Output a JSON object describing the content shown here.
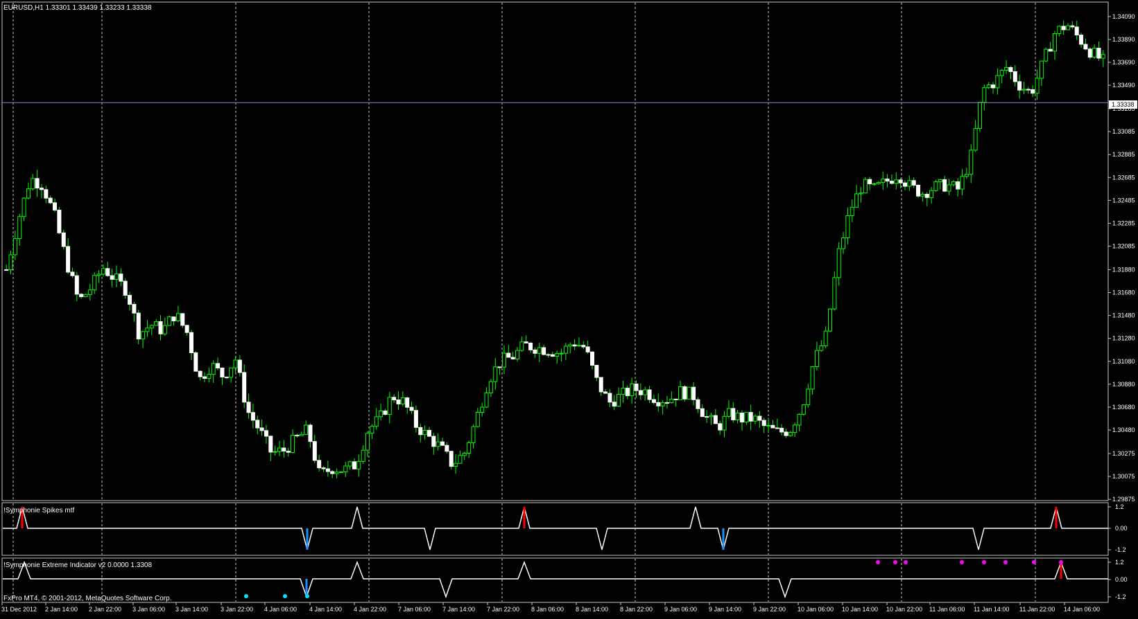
{
  "symbol_header": "EURUSD,H1  1.33301 1.33439 1.33233 1.33338",
  "current_price_label": "1.33338",
  "current_price": 1.33338,
  "price_ticks": [
    "1.34090",
    "1.33890",
    "1.33690",
    "1.33490",
    "1.33285",
    "1.33085",
    "1.32885",
    "1.32685",
    "1.32485",
    "1.32285",
    "1.32085",
    "1.31880",
    "1.31680",
    "1.31480",
    "1.31280",
    "1.31080",
    "1.30880",
    "1.30680",
    "1.30480",
    "1.30275",
    "1.30075",
    "1.29875"
  ],
  "price_tick_values": [
    1.3409,
    1.3389,
    1.3369,
    1.3349,
    1.33285,
    1.33085,
    1.32885,
    1.32685,
    1.32485,
    1.32285,
    1.32085,
    1.3188,
    1.3168,
    1.3148,
    1.3128,
    1.3108,
    1.3088,
    1.3068,
    1.3048,
    1.30275,
    1.30075,
    1.29875
  ],
  "price_range": [
    1.2987,
    1.3421
  ],
  "indicator1": {
    "label": "!Symphonie Spikes mtf",
    "ticks": [
      "1.2",
      "0.00",
      "-1.2"
    ],
    "tick_values": [
      1.2,
      0,
      -1.2
    ],
    "range": [
      -1.2,
      1.2
    ]
  },
  "indicator2": {
    "label": "!Symphonie Extreme Indicator v2 0.0000 1.3308",
    "ticks": [
      "1.2",
      "0.00",
      "-1.2"
    ],
    "tick_values": [
      1.2,
      0,
      -1.2
    ],
    "range": [
      -1.2,
      1.2
    ]
  },
  "copyright": "FxPro MT4, © 2001-2012, MetaQuotes Software Corp.",
  "time_labels": [
    "31 Dec 2012",
    "2 Jan 14:00",
    "2 Jan 22:00",
    "3 Jan 06:00",
    "3 Jan 14:00",
    "3 Jan 22:00",
    "4 Jan 06:00",
    "4 Jan 14:00",
    "4 Jan 22:00",
    "7 Jan 06:00",
    "7 Jan 14:00",
    "7 Jan 22:00",
    "8 Jan 06:00",
    "8 Jan 14:00",
    "8 Jan 22:00",
    "9 Jan 06:00",
    "9 Jan 14:00",
    "9 Jan 22:00",
    "10 Jan 06:00",
    "10 Jan 14:00",
    "10 Jan 22:00",
    "11 Jan 06:00",
    "11 Jan 14:00",
    "11 Jan 22:00",
    "14 Jan 06:00"
  ],
  "colors": {
    "bull": "#00ff00",
    "bear": "#ffffff",
    "wick": "#00ff00",
    "grid": "#ffffff",
    "price_line": "#7f8fbf",
    "spike_red": "#ff0000",
    "spike_blue": "#1e90ff",
    "dot_cyan": "#00e5ff",
    "dot_magenta": "#ff00ff"
  },
  "chart_data": {
    "type": "candlestick",
    "close_path": [
      1.3188,
      1.3232,
      1.3268,
      1.3262,
      1.3235,
      1.3195,
      1.316,
      1.3172,
      1.319,
      1.318,
      1.317,
      1.3132,
      1.314,
      1.3135,
      1.315,
      1.3133,
      1.3092,
      1.3105,
      1.3095,
      1.311,
      1.3065,
      1.3048,
      1.3028,
      1.303,
      1.304,
      1.3048,
      1.3008,
      1.3015,
      1.3013,
      1.3018,
      1.3048,
      1.3058,
      1.3078,
      1.3072,
      1.3052,
      1.3042,
      1.3033,
      1.3018,
      1.3028,
      1.3058,
      1.3092,
      1.3108,
      1.3112,
      1.3122,
      1.312,
      1.3118,
      1.3115,
      1.3125,
      1.312,
      1.309,
      1.3072,
      1.3078,
      1.3084,
      1.3082,
      1.3075,
      1.3075,
      1.3082,
      1.3078,
      1.306,
      1.305,
      1.3062,
      1.3058,
      1.3058,
      1.305,
      1.3046,
      1.3048,
      1.3068,
      1.3108,
      1.313,
      1.32,
      1.324,
      1.3262,
      1.3258,
      1.3265,
      1.3272,
      1.326,
      1.3255,
      1.326,
      1.3262,
      1.3258,
      1.3285,
      1.3345,
      1.3352,
      1.3365,
      1.335,
      1.3342,
      1.3368,
      1.3395,
      1.3402,
      1.339,
      1.3378,
      1.337
    ]
  }
}
